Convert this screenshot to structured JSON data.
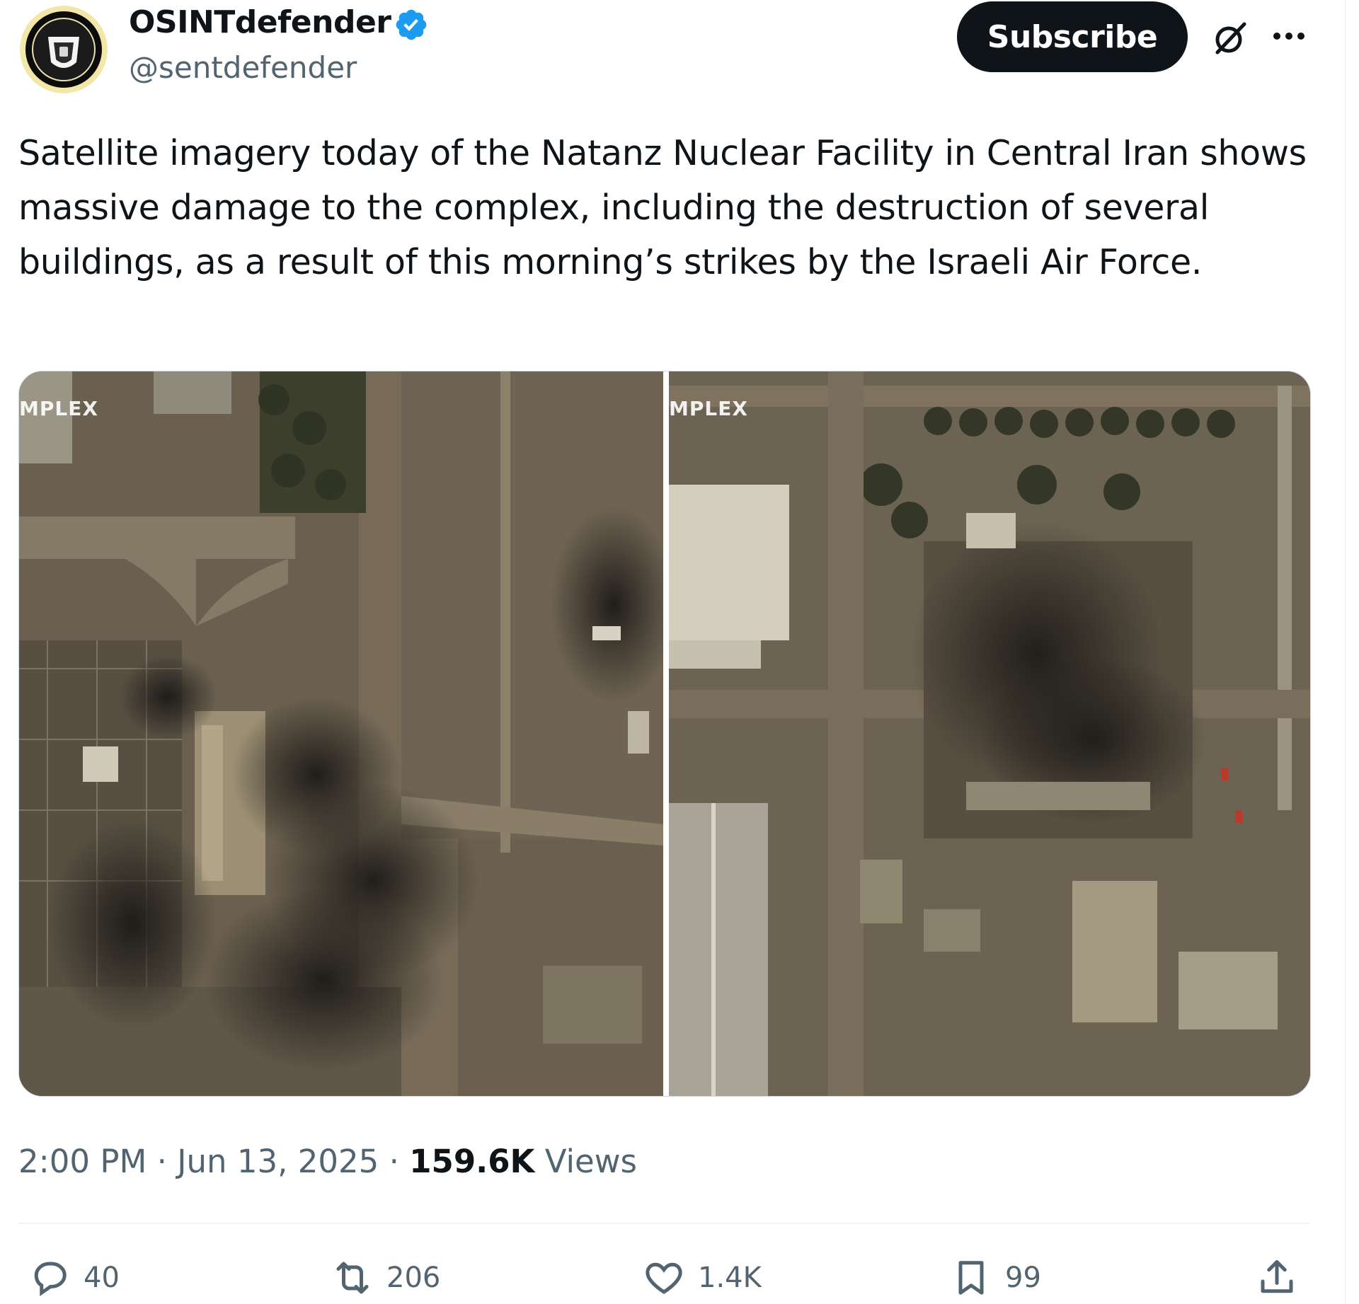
{
  "author": {
    "display_name": "OSINTdefender",
    "handle": "@sentdefender",
    "verified": true
  },
  "header": {
    "subscribe_label": "Subscribe",
    "grok_icon": "grok-icon",
    "more_icon": "more-icon"
  },
  "tweet": {
    "text": "Satellite imagery today of the Natanz Nuclear Facility in Central Iran shows massive damage to the complex, including the destruction of several buildings, as a result of this morning’s strikes by the Israeli Air Force.",
    "media": {
      "left_label": "MPLEX",
      "right_label": "MPLEX"
    }
  },
  "meta": {
    "time": "2:00 PM",
    "separator": "·",
    "date": "Jun 13, 2025",
    "views_count": "159.6K",
    "views_label": "Views"
  },
  "actions": {
    "replies": "40",
    "reposts": "206",
    "likes": "1.4K",
    "bookmarks": "99"
  },
  "colors": {
    "text_primary": "#0f1419",
    "text_secondary": "#536471",
    "verified_blue": "#1d9bf0",
    "subscribe_bg": "#0f1419"
  }
}
